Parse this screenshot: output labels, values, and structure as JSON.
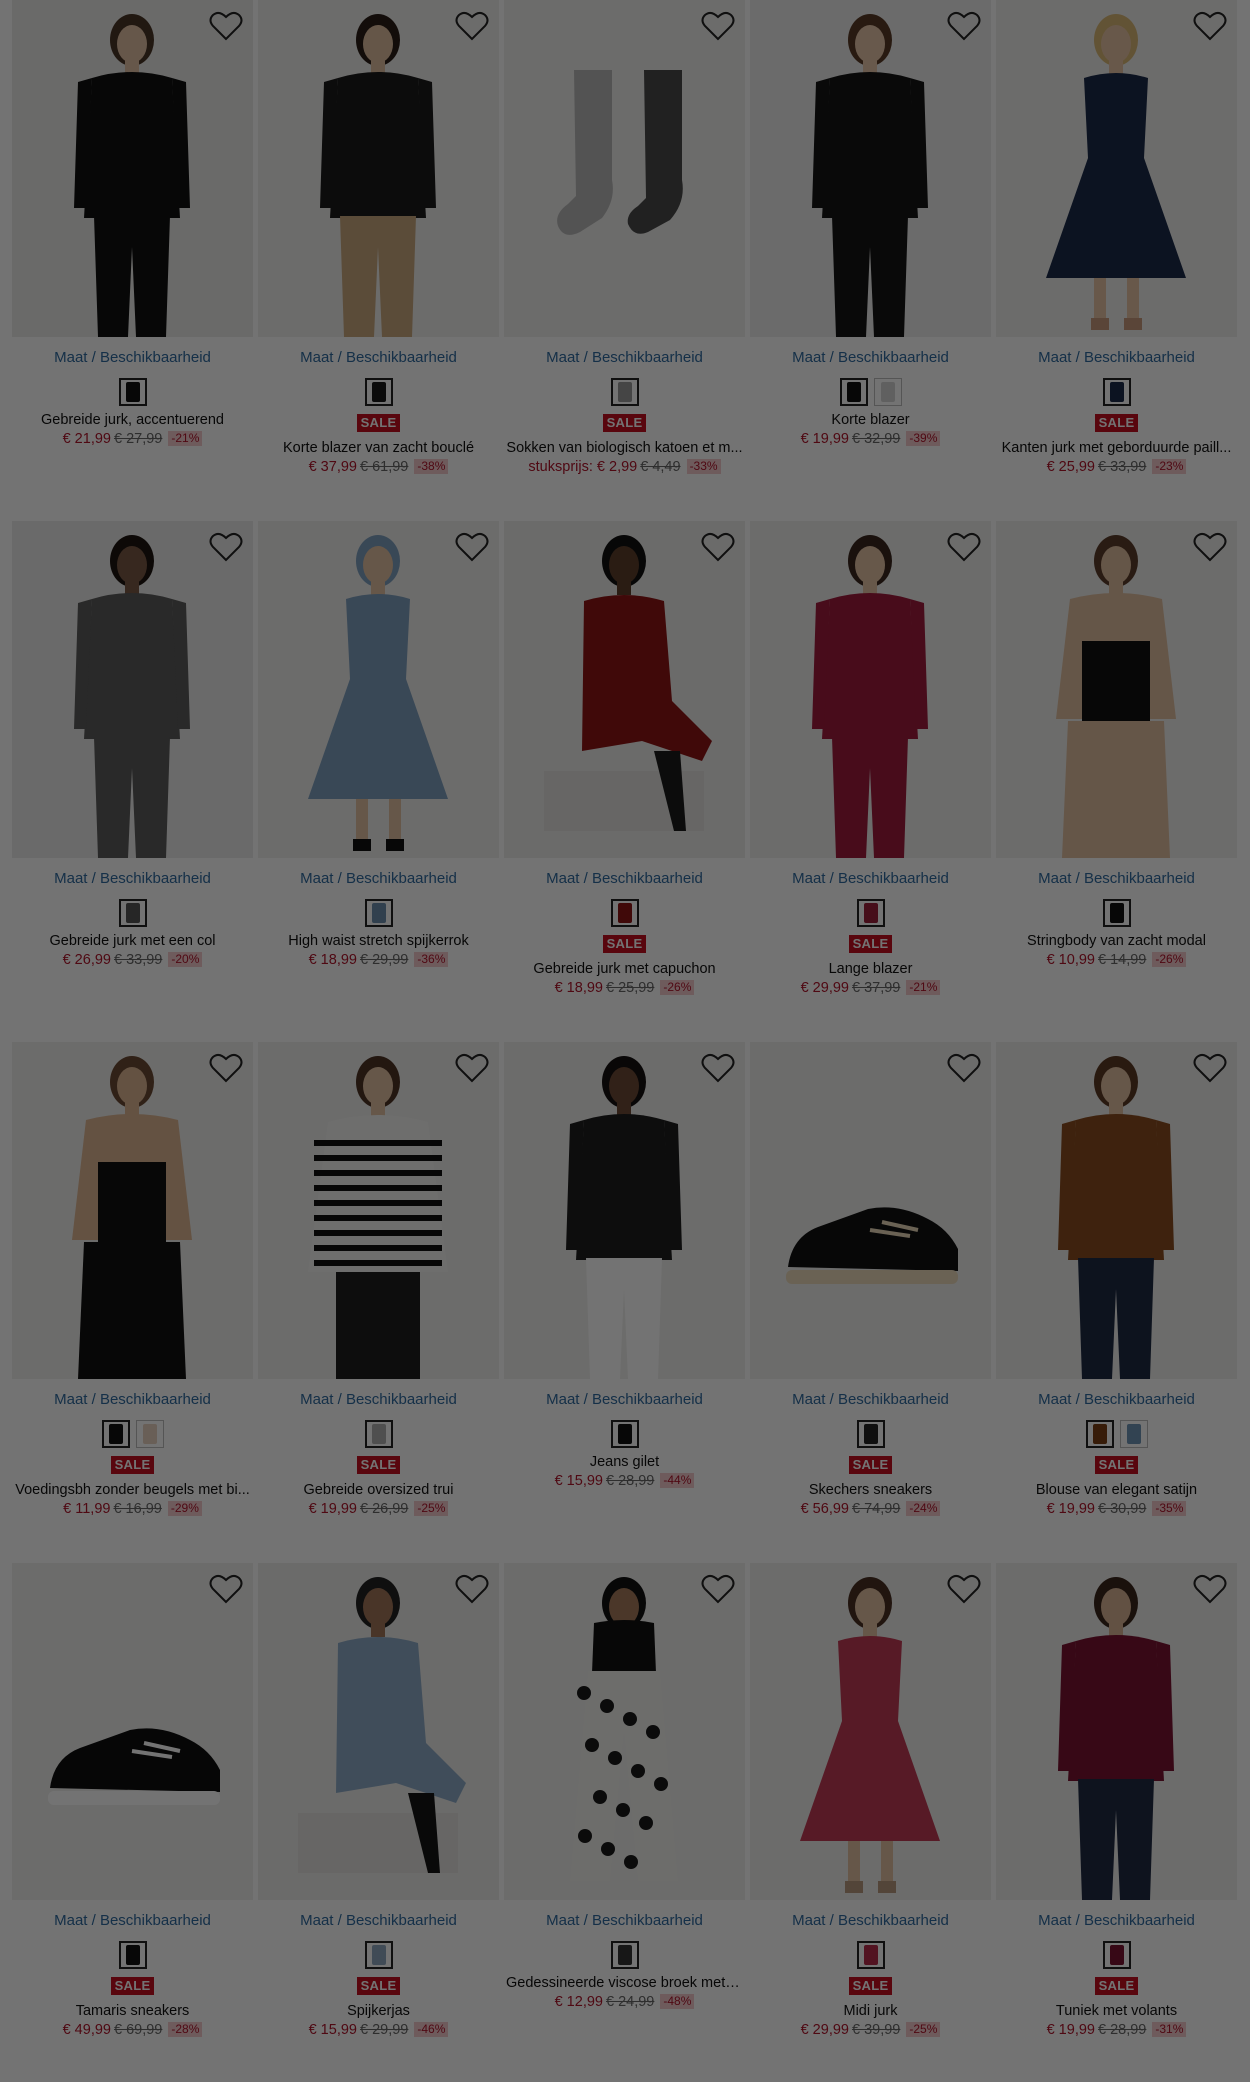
{
  "size_link_label": "Maat / Beschikbaarheid",
  "sale_label": "SALE",
  "products": [
    {
      "title": "Gebreide jurk, accentuerend",
      "price": "€ 21,99",
      "old_price": "€ 27,99",
      "discount": "-21%",
      "sale": false,
      "unit_prefix": "",
      "swatches": [
        "#111111"
      ],
      "photo": {
        "kind": "person",
        "bg": "#ecebe9",
        "top": "#111111",
        "bottom": "#111111",
        "hair": "#4b3527",
        "skin": "#e3c2a4",
        "shoes": "#111111"
      }
    },
    {
      "title": "Korte blazer van zacht bouclé",
      "price": "€ 37,99",
      "old_price": "€ 61,99",
      "discount": "-38%",
      "sale": true,
      "unit_prefix": "",
      "swatches": [
        "#1a1a1a"
      ],
      "photo": {
        "kind": "person",
        "bg": "#f0efed",
        "top": "#1b1b1b",
        "bottom": "#c9a87e",
        "hair": "#2a1d17",
        "skin": "#e0bfa1",
        "shoes": "#333333"
      }
    },
    {
      "title": "Sokken van biologisch katoen et m...",
      "price": "€ 2,99",
      "old_price": "€ 4,49",
      "discount": "-33%",
      "sale": true,
      "unit_prefix": "stuksprijs: ",
      "swatches": [
        "#9a9a9a"
      ],
      "photo": {
        "kind": "socks",
        "bg": "#efefee",
        "top": "#b8b8b8",
        "bottom": "#4a4a4a"
      }
    },
    {
      "title": "Korte blazer",
      "price": "€ 19,99",
      "old_price": "€ 32,99",
      "discount": "-39%",
      "sale": false,
      "unit_prefix": "",
      "swatches": [
        "#111111",
        "#d6d6d6"
      ],
      "photo": {
        "kind": "person",
        "bg": "#eeeeed",
        "top": "#151515",
        "bottom": "#151515",
        "hair": "#5a3b27",
        "skin": "#e6c6a8",
        "shoes": "#151515"
      }
    },
    {
      "title": "Kanten jurk met geborduurde paill...",
      "price": "€ 25,99",
      "old_price": "€ 33,99",
      "discount": "-23%",
      "sale": true,
      "unit_prefix": "",
      "swatches": [
        "#1c2a4a"
      ],
      "photo": {
        "kind": "dress",
        "bg": "#efefee",
        "top": "#1c2a4a",
        "bottom": "#1c2a4a",
        "hair": "#d9b877",
        "skin": "#e7c4a4",
        "shoes": "#c89a7c"
      }
    },
    {
      "title": "Gebreide jurk met een col",
      "price": "€ 26,99",
      "old_price": "€ 33,99",
      "discount": "-20%",
      "sale": false,
      "unit_prefix": "",
      "swatches": [
        "#555555"
      ],
      "photo": {
        "kind": "person",
        "bg": "#ececeb",
        "top": "#5b5b5b",
        "bottom": "#5b5b5b",
        "hair": "#1e1410",
        "skin": "#7a5a45",
        "shoes": "#111111"
      }
    },
    {
      "title": "High waist stretch spijkerrok",
      "price": "€ 18,99",
      "old_price": "€ 29,99",
      "discount": "-36%",
      "sale": false,
      "unit_prefix": "",
      "swatches": [
        "#6d8fae"
      ],
      "photo": {
        "kind": "dress",
        "bg": "#efefee",
        "top": "#7f9fbf",
        "bottom": "#7596b8",
        "hair": "#7f9fbf",
        "skin": "#e2c1a2",
        "shoes": "#111111"
      }
    },
    {
      "title": "Gebreide jurk met capuchon",
      "price": "€ 18,99",
      "old_price": "€ 25,99",
      "discount": "-26%",
      "sale": true,
      "unit_prefix": "",
      "swatches": [
        "#8e1414"
      ],
      "photo": {
        "kind": "seated",
        "bg": "#eeedeb",
        "top": "#8e1414",
        "bottom": "#8e1414",
        "hair": "#111111",
        "skin": "#5e3f2c",
        "shoes": "#1b1b1b"
      }
    },
    {
      "title": "Lange blazer",
      "price": "€ 29,99",
      "old_price": "€ 37,99",
      "discount": "-21%",
      "sale": true,
      "unit_prefix": "",
      "swatches": [
        "#9c1f3a"
      ],
      "photo": {
        "kind": "person",
        "bg": "#efefee",
        "top": "#a01b3c",
        "bottom": "#a01b3c",
        "hair": "#3a271d",
        "skin": "#e4c3a5",
        "shoes": "#a01b3c"
      }
    },
    {
      "title": "Stringbody van zacht modal",
      "price": "€ 10,99",
      "old_price": "€ 14,99",
      "discount": "-26%",
      "sale": false,
      "unit_prefix": "",
      "swatches": [
        "#111111"
      ],
      "photo": {
        "kind": "body",
        "bg": "#efefee",
        "top": "#111111",
        "bottom": "#e1bf9f",
        "hair": "#5b3d2a",
        "skin": "#e1bf9f",
        "shoes": "#e1bf9f"
      }
    },
    {
      "title": "Voedingsbh zonder beugels met bi...",
      "price": "€ 11,99",
      "old_price": "€ 16,99",
      "discount": "-29%",
      "sale": true,
      "unit_prefix": "",
      "swatches": [
        "#111111",
        "#e8d2c0"
      ],
      "photo": {
        "kind": "body",
        "bg": "#f0efed",
        "top": "#111111",
        "bottom": "#111111",
        "hair": "#6b4a33",
        "skin": "#ddb592",
        "shoes": "#111111"
      }
    },
    {
      "title": "Gebreide oversized trui",
      "price": "€ 19,99",
      "old_price": "€ 26,99",
      "discount": "-25%",
      "sale": true,
      "unit_prefix": "",
      "swatches": [
        "#b0b0b0"
      ],
      "photo": {
        "kind": "stripes",
        "bg": "#efefee",
        "top": "#f4f4f2",
        "bottom": "#1d1d1d",
        "hair": "#4e3324",
        "skin": "#e3c2a3",
        "shoes": "#1d1d1d"
      }
    },
    {
      "title": "Jeans gilet",
      "price": "€ 15,99",
      "old_price": "€ 28,99",
      "discount": "-44%",
      "sale": false,
      "unit_prefix": "",
      "swatches": [
        "#111111"
      ],
      "photo": {
        "kind": "person",
        "bg": "#efefee",
        "top": "#1e1e1e",
        "bottom": "#ffffff",
        "hair": "#151010",
        "skin": "#6d4a35",
        "shoes": "#ffffff"
      }
    },
    {
      "title": "Skechers sneakers",
      "price": "€ 56,99",
      "old_price": "€ 74,99",
      "discount": "-24%",
      "sale": true,
      "unit_prefix": "",
      "swatches": [
        "#222222"
      ],
      "photo": {
        "kind": "shoe",
        "bg": "#efefee",
        "top": "#111111",
        "bottom": "#ead9bb"
      }
    },
    {
      "title": "Blouse van elegant satijn",
      "price": "€ 19,99",
      "old_price": "€ 30,99",
      "discount": "-35%",
      "sale": true,
      "unit_prefix": "",
      "swatches": [
        "#7a3e14",
        "#6f94b6"
      ],
      "photo": {
        "kind": "person",
        "bg": "#efefee",
        "top": "#8a4d1f",
        "bottom": "#1e2a44",
        "hair": "#5c3a25",
        "skin": "#e3c2a3",
        "shoes": "#1e2a44"
      }
    },
    {
      "title": "Tamaris sneakers",
      "price": "€ 49,99",
      "old_price": "€ 69,99",
      "discount": "-28%",
      "sale": true,
      "unit_prefix": "",
      "swatches": [
        "#111111"
      ],
      "photo": {
        "kind": "shoe",
        "bg": "#efefee",
        "top": "#0e0e0e",
        "bottom": "#ffffff"
      }
    },
    {
      "title": "Spijkerjas",
      "price": "€ 15,99",
      "old_price": "€ 29,99",
      "discount": "-46%",
      "sale": true,
      "unit_prefix": "",
      "swatches": [
        "#8ea7bf"
      ],
      "photo": {
        "kind": "seated",
        "bg": "#eeeeec",
        "top": "#8eacc8",
        "bottom": "#8eacc8",
        "hair": "#222222",
        "skin": "#a37659",
        "shoes": "#151515"
      }
    },
    {
      "title": "Gedessineerde viscose broek met s...",
      "price": "€ 12,99",
      "old_price": "€ 24,99",
      "discount": "-48%",
      "sale": false,
      "unit_prefix": "",
      "swatches": [
        "#333333"
      ],
      "photo": {
        "kind": "pants",
        "bg": "#f0efed",
        "top": "#111111",
        "bottom": "#1a1a1a",
        "hair": "#111111",
        "skin": "#a67a5c",
        "shoes": "#1a1a1a"
      }
    },
    {
      "title": "Midi jurk",
      "price": "€ 29,99",
      "old_price": "€ 39,99",
      "discount": "-25%",
      "sale": true,
      "unit_prefix": "",
      "swatches": [
        "#b52a4a"
      ],
      "photo": {
        "kind": "dress",
        "bg": "#efefee",
        "top": "#c23a55",
        "bottom": "#c23a55",
        "hair": "#4a3022",
        "skin": "#e3c2a3",
        "shoes": "#b89a7e"
      }
    },
    {
      "title": "Tuniek met volants",
      "price": "€ 19,99",
      "old_price": "€ 28,99",
      "discount": "-31%",
      "sale": true,
      "unit_prefix": "",
      "swatches": [
        "#7b1231"
      ],
      "photo": {
        "kind": "person",
        "bg": "#efefee",
        "top": "#7b1231",
        "bottom": "#1f2a44",
        "hair": "#3a261b",
        "skin": "#d9b394",
        "shoes": "#1f2a44"
      }
    }
  ]
}
